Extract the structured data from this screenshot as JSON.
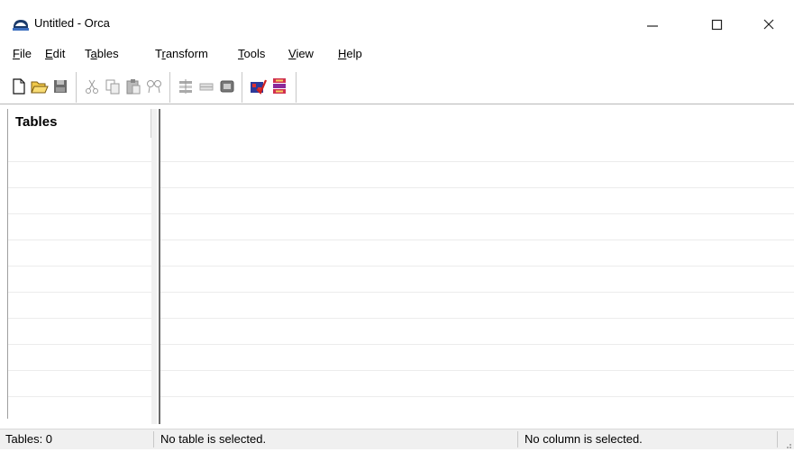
{
  "window": {
    "title": "Untitled - Orca",
    "app_icon": "orca-whale-icon",
    "controls": [
      "minimize-icon",
      "maximize-icon",
      "close-icon"
    ]
  },
  "menu": [
    {
      "label": "File",
      "mnemonic": "F",
      "rest": "ile"
    },
    {
      "label": "Edit",
      "mnemonic": "E",
      "rest": "dit"
    },
    {
      "label": "Tables",
      "prefix": "T",
      "mnemonic": "a",
      "rest": "bles"
    },
    {
      "label": "Transform",
      "prefix": "T",
      "mnemonic": "r",
      "rest": "ansform"
    },
    {
      "label": "Tools",
      "mnemonic": "T",
      "rest": "ools"
    },
    {
      "label": "View",
      "mnemonic": "V",
      "rest": "iew"
    },
    {
      "label": "Help",
      "mnemonic": "H",
      "rest": "elp"
    }
  ],
  "toolbar": [
    "new-icon",
    "open-icon",
    "save-icon",
    "cut-icon",
    "copy-icon",
    "paste-icon",
    "find-icon",
    "add-row-icon",
    "drop-row-icon",
    "table-icon",
    "validate-icon",
    "merge-module-icon"
  ],
  "left_pane": {
    "header": "Tables"
  },
  "status": {
    "tables": "Tables: 0",
    "table_sel": "No table is selected.",
    "column_sel": "No column is selected."
  }
}
